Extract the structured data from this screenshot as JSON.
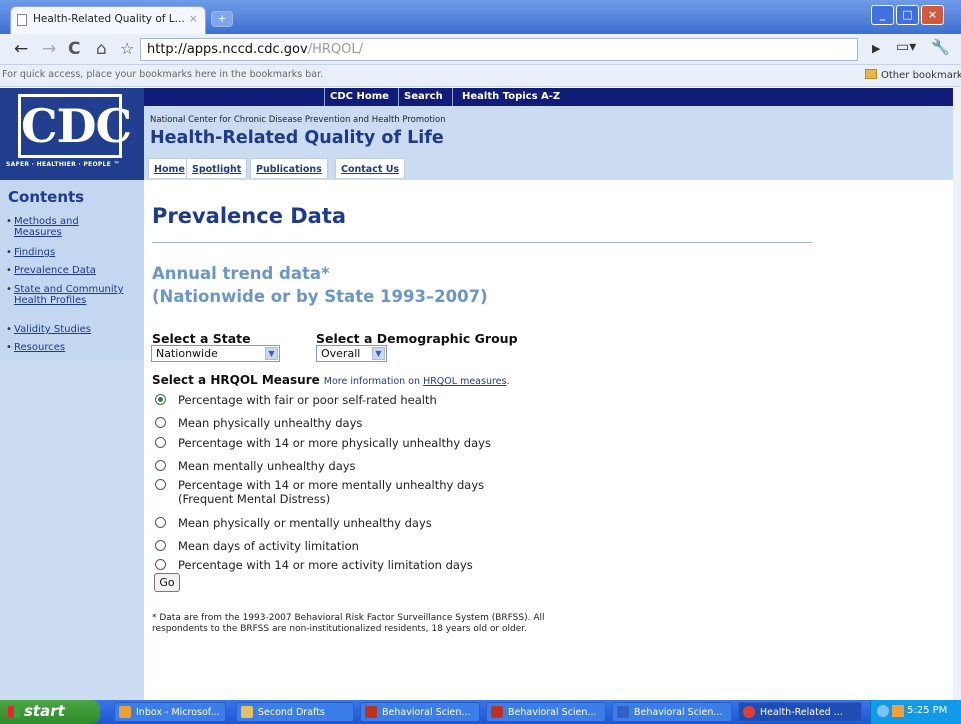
{
  "browser": {
    "tab_title": "Health-Related Quality of L...",
    "tab_close": "×",
    "new_tab": "+",
    "url_host": "http://apps.nccd.cdc.gov",
    "url_path": "/HRQOL/",
    "bookmarks_hint": "For quick access, place your bookmarks here in the bookmarks bar.",
    "other_bookmarks": "Other bookmarks"
  },
  "site": {
    "logo_text": "CDC",
    "logo_tagline": "SAFER · HEALTHIER · PEOPLE ™",
    "top_links": [
      "CDC Home",
      "Search",
      "Health Topics A-Z"
    ],
    "center_name": "National Center for Chronic Disease Prevention and Health Promotion",
    "title": "Health-Related Quality of Life",
    "subnav": [
      "Home",
      "Spotlight",
      "Publications",
      "Contact Us"
    ]
  },
  "sidebar": {
    "title": "Contents",
    "items": [
      {
        "label": "Methods and Measures"
      },
      {
        "label": "Findings"
      },
      {
        "label": "Prevalence Data"
      },
      {
        "label": "State and Community Health Profiles"
      },
      {
        "label": "Validity Studies"
      },
      {
        "label": "Resources"
      }
    ]
  },
  "main": {
    "page_title": "Prevalence Data",
    "subheading_line1": "Annual trend data*",
    "subheading_line2": "(Nationwide or by State 1993–2007)",
    "state_label": "Select a State",
    "state_value": "Nationwide",
    "demo_label": "Select a Demographic Group",
    "demo_value": "Overall",
    "measure_label": "Select a HRQOL Measure",
    "more_info_prefix": "More information on",
    "more_info_link": "HRQOL measures",
    "more_info_suffix": ".",
    "options": [
      {
        "label": "Percentage with fair or poor self-rated health",
        "selected": true
      },
      {
        "label": "Mean physically unhealthy days",
        "selected": false
      },
      {
        "label": "Percentage with 14 or more physically unhealthy days",
        "selected": false
      },
      {
        "label": "Mean mentally unhealthy days",
        "selected": false
      },
      {
        "label": "Percentage with 14 or more mentally unhealthy days",
        "label2": "(Frequent Mental Distress)",
        "selected": false
      },
      {
        "label": "Mean physically or mentally unhealthy days",
        "selected": false
      },
      {
        "label": "Mean days of activity limitation",
        "selected": false
      },
      {
        "label": "Percentage with 14 or more activity limitation days",
        "selected": false
      }
    ],
    "go_label": "Go",
    "footnote": "* Data are from the 1993-2007 Behavioral Risk Factor Surveillance System (BRFSS). All respondents to the BRFSS are non-institutionalized residents, 18 years old or older."
  },
  "taskbar": {
    "start_label": "start",
    "items": [
      {
        "label": "Inbox - Microsof...",
        "icon_color": "#f0a030"
      },
      {
        "label": "Second Drafts",
        "icon_color": "#e8c060"
      },
      {
        "label": "Behavioral Scien...",
        "icon_color": "#c03020"
      },
      {
        "label": "Behavioral Scien...",
        "icon_color": "#c03020"
      },
      {
        "label": "Behavioral Scien...",
        "icon_color": "#3060c0"
      },
      {
        "label": "Health-Related ...",
        "icon_color": "#e04030"
      }
    ],
    "clock": "5:25 PM"
  },
  "colors": {
    "brand_navy": "#223f8f",
    "link_blue": "#1e3a8a",
    "subheading_blue": "#6b96c9",
    "sidebar_bg": "#c4d7f0"
  }
}
